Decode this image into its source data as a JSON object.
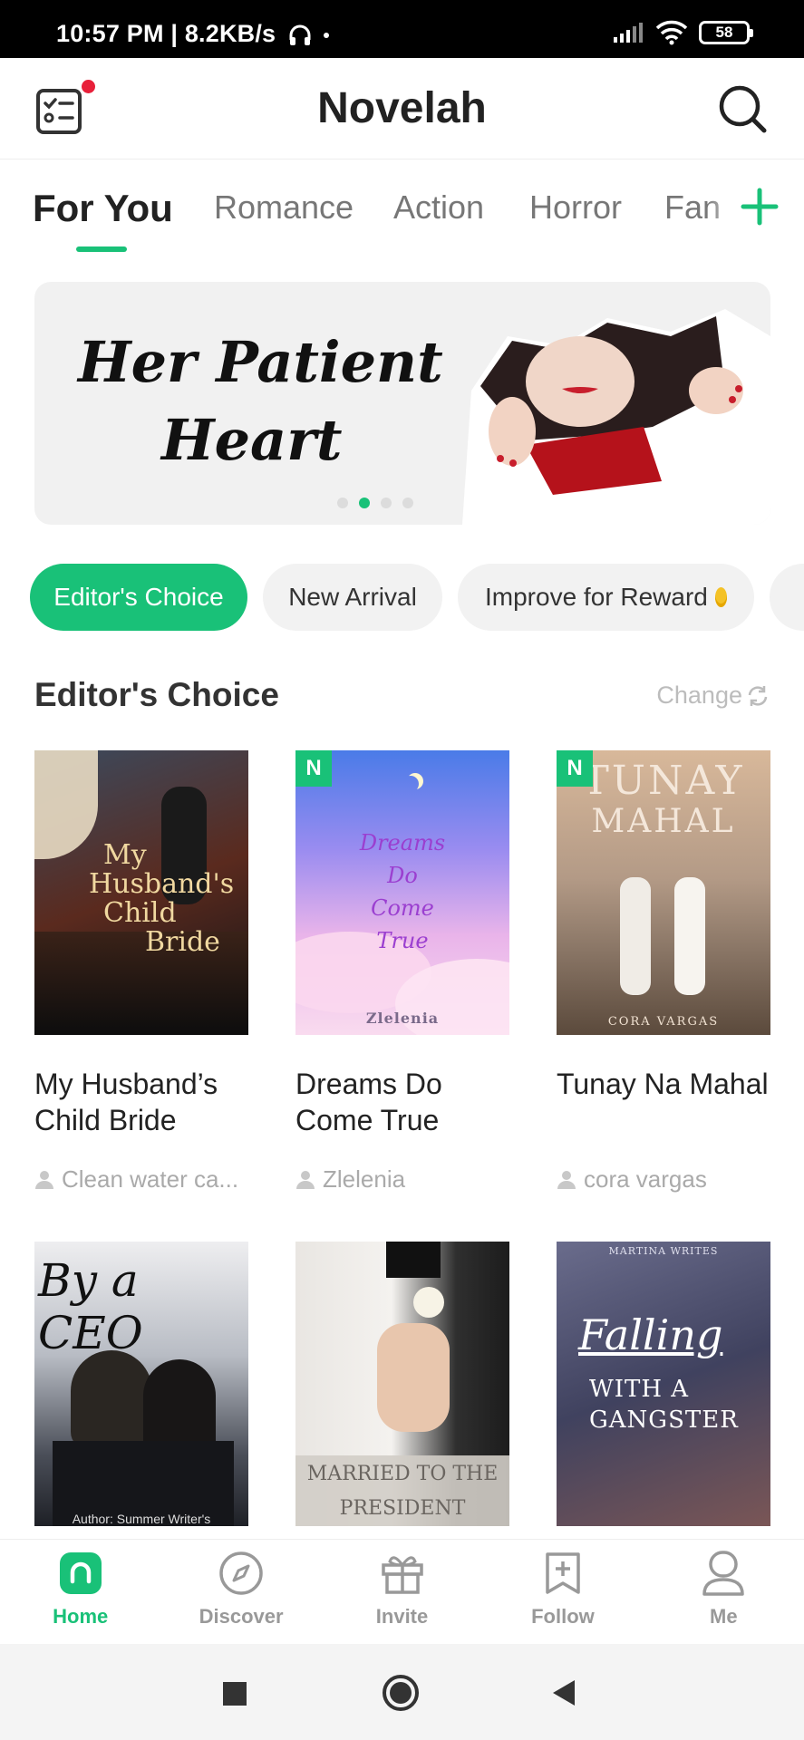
{
  "status_bar": {
    "time": "10:57 PM | 8.2KB/s",
    "battery": "58"
  },
  "header": {
    "title": "Novelah"
  },
  "tabs": [
    {
      "label": "For You",
      "active": true
    },
    {
      "label": "Romance"
    },
    {
      "label": "Action"
    },
    {
      "label": "Horror"
    },
    {
      "label": "Fan"
    }
  ],
  "banner": {
    "line1": "Her Patient",
    "line2": "Heart",
    "active_slide": 2,
    "slide_count": 4
  },
  "chips": [
    {
      "label": "Editor's Choice",
      "active": true
    },
    {
      "label": "New Arrival"
    },
    {
      "label": "Improve for Reward"
    }
  ],
  "section": {
    "title": "Editor's Choice",
    "change_label": "Change"
  },
  "books": [
    {
      "title": "My Husband’s Child Bride",
      "author": "Clean water ca...",
      "cover_text": [
        "My",
        "Husband's",
        "Child",
        "Bride"
      ],
      "badge": "",
      "cover_colors": [
        "#2b3440",
        "#5a2a1e",
        "#101418"
      ]
    },
    {
      "title": "Dreams Do Come True",
      "author": "Zlelenia",
      "cover_text": [
        "Dreams",
        "Do",
        "Come",
        "True",
        "Zlelenia"
      ],
      "badge": "N",
      "cover_colors": [
        "#4a7be8",
        "#c9a6f0",
        "#f6c6e6"
      ]
    },
    {
      "title": "Tunay Na Mahal",
      "author": "cora vargas",
      "cover_text": [
        "TUNAY",
        "MAHAL",
        "CORA VARGAS"
      ],
      "badge": "N",
      "cover_colors": [
        "#c9a688",
        "#8c7868",
        "#5b4a3c"
      ]
    },
    {
      "title": "",
      "author": "",
      "cover_text": [
        "By a CEO",
        "Author: Summer Writer's"
      ],
      "badge": "",
      "cover_colors": [
        "#e6e6ea",
        "#8e939e",
        "#2a2c33"
      ]
    },
    {
      "title": "",
      "author": "",
      "cover_text": [
        "MARRIED TO THE",
        "PRESIDENT"
      ],
      "badge": "",
      "cover_colors": [
        "#3a3a3a",
        "#e8e4df",
        "#cfc9c2"
      ]
    },
    {
      "title": "",
      "author": "",
      "cover_text": [
        "MARTINA WRITES",
        "Falling",
        "WITH A",
        "GANGSTER"
      ],
      "badge": "",
      "cover_colors": [
        "#5a5c7a",
        "#3b3d5c",
        "#7a5a5a"
      ]
    }
  ],
  "bottom_nav": [
    {
      "label": "Home",
      "icon": "home-icon",
      "active": true
    },
    {
      "label": "Discover",
      "icon": "compass-icon"
    },
    {
      "label": "Invite",
      "icon": "gift-icon"
    },
    {
      "label": "Follow",
      "icon": "bookmark-plus-icon"
    },
    {
      "label": "Me",
      "icon": "person-icon"
    }
  ],
  "colors": {
    "accent": "#19c178",
    "notification_dot": "#e8203a"
  }
}
